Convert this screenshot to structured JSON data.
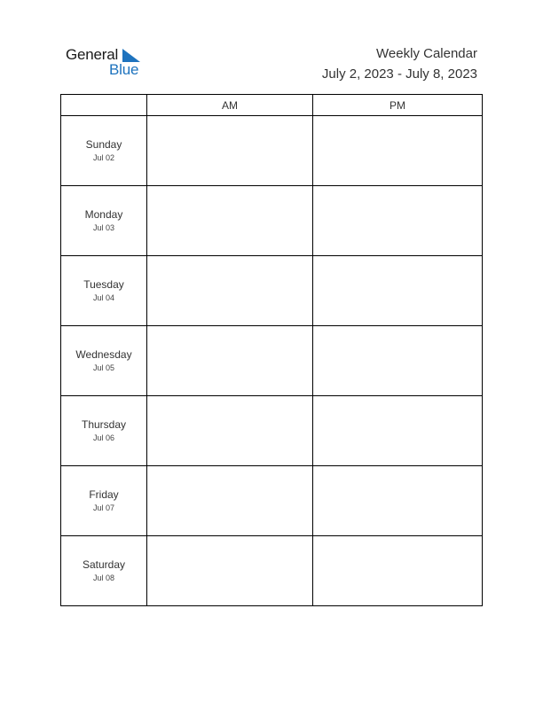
{
  "logo": {
    "word1": "General",
    "word2": "Blue",
    "brand_color": "#1e73be"
  },
  "header": {
    "title": "Weekly Calendar",
    "date_range": "July 2, 2023 - July 8, 2023"
  },
  "table": {
    "columns": [
      "",
      "AM",
      "PM"
    ],
    "rows": [
      {
        "day": "Sunday",
        "date": "Jul 02",
        "am": "",
        "pm": ""
      },
      {
        "day": "Monday",
        "date": "Jul 03",
        "am": "",
        "pm": ""
      },
      {
        "day": "Tuesday",
        "date": "Jul 04",
        "am": "",
        "pm": ""
      },
      {
        "day": "Wednesday",
        "date": "Jul 05",
        "am": "",
        "pm": ""
      },
      {
        "day": "Thursday",
        "date": "Jul 06",
        "am": "",
        "pm": ""
      },
      {
        "day": "Friday",
        "date": "Jul 07",
        "am": "",
        "pm": ""
      },
      {
        "day": "Saturday",
        "date": "Jul 08",
        "am": "",
        "pm": ""
      }
    ]
  }
}
